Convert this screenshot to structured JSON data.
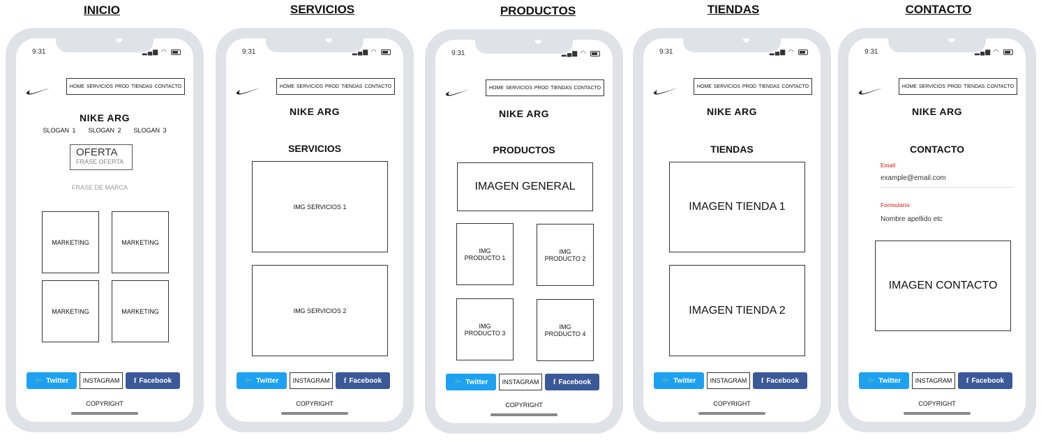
{
  "screens": [
    {
      "title": "INICIO"
    },
    {
      "title": "SERVICIOS"
    },
    {
      "title": "PRODUCTOS"
    },
    {
      "title": "TIENDAS"
    },
    {
      "title": "CONTACTO"
    }
  ],
  "status": {
    "time": "9:31"
  },
  "nav": {
    "items": [
      "HOME",
      "SERVICIOS",
      "PROD",
      "TIENDAS",
      "CONTACTO"
    ]
  },
  "brand": "NIKE ARG",
  "footer": {
    "twitter": "Twitter",
    "instagram": "INSTAGRAM",
    "facebook": "Facebook",
    "copyright": "COPYRIGHT"
  },
  "inicio": {
    "slogans": [
      "SLOGAN 1",
      "SLOGAN 2",
      "SLOGAN 3"
    ],
    "oferta_title": "OFERTA",
    "oferta_phrase": "FRASE OFERTA",
    "brand_phrase": "FRASE DE MARCA",
    "marketing": [
      "MARKETING",
      "MARKETING",
      "MARKETING",
      "MARKETING"
    ]
  },
  "servicios": {
    "title": "SERVICIOS",
    "images": [
      "IMG SERVICIOS 1",
      "IMG SERVICIOS 2"
    ]
  },
  "productos": {
    "title": "PRODUCTOS",
    "general": "IMAGEN GENERAL",
    "products": [
      "IMG PRODUCTO 1",
      "IMG PRODUCTO 2",
      "IMG PRODUCTO 3",
      "IMG PRODUCTO 4"
    ]
  },
  "tiendas": {
    "title": "TIENDAS",
    "images": [
      "IMAGEN TIENDA 1",
      "IMAGEN TIENDA 2"
    ]
  },
  "contacto": {
    "title": "CONTACTO",
    "email_label": "Email",
    "email_value": "example@email.com",
    "form_label": "Formulario",
    "form_value": "Nombre apellido etc",
    "image": "IMAGEN CONTACTO"
  },
  "colors": {
    "twitter": "#1da1f2",
    "facebook": "#3b5998",
    "label_red": "#d9534f",
    "phone_frame": "#dfe2e7"
  }
}
